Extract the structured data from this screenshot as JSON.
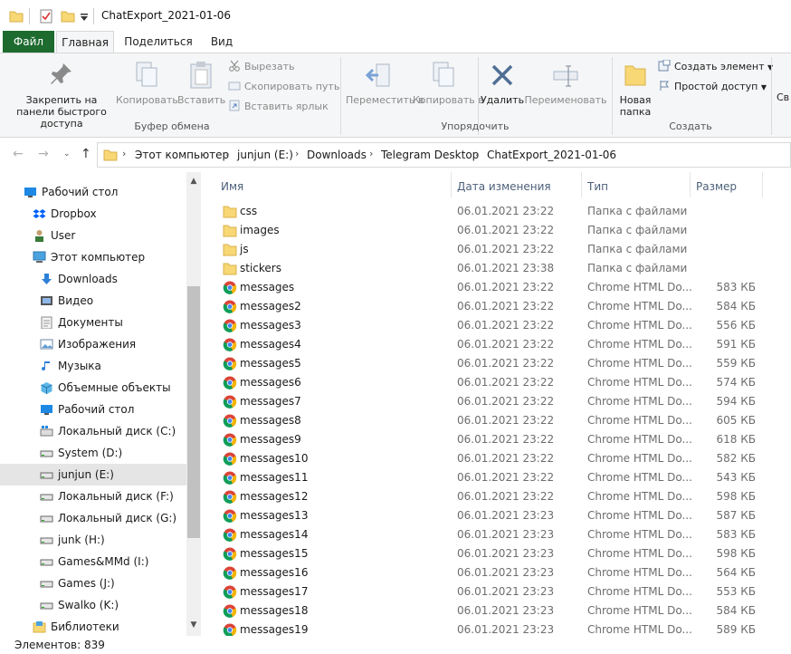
{
  "window": {
    "title": "ChatExport_2021-01-06"
  },
  "ribbon_tabs": {
    "file": "Файл",
    "home": "Главная",
    "share": "Поделиться",
    "view": "Вид"
  },
  "ribbon": {
    "pin": "Закрепить на панели быстрого доступа",
    "copy": "Копировать",
    "paste": "Вставить",
    "cut": "Вырезать",
    "copy_path": "Скопировать путь",
    "paste_shortcut": "Вставить ярлык",
    "clipboard_group": "Буфер обмена",
    "move_to": "Переместить в",
    "copy_to": "Копировать в",
    "delete": "Удалить",
    "rename": "Переименовать",
    "organize_group": "Упорядочить",
    "new_folder": "Новая папка",
    "new_item": "Создать элемент",
    "easy_access": "Простой доступ",
    "new_group": "Создать",
    "properties_partial": "Св"
  },
  "address": {
    "crumbs": [
      "Этот компьютер",
      "junjun (E:)",
      "Downloads",
      "Telegram Desktop",
      "ChatExport_2021-01-06"
    ]
  },
  "nav": [
    {
      "label": "Рабочий стол",
      "icon": "desktop-icon"
    },
    {
      "label": "Dropbox",
      "icon": "dropbox-icon"
    },
    {
      "label": "User",
      "icon": "user-icon"
    },
    {
      "label": "Этот компьютер",
      "icon": "computer-icon"
    },
    {
      "label": "Downloads",
      "icon": "download-icon"
    },
    {
      "label": "Видео",
      "icon": "video-icon"
    },
    {
      "label": "Документы",
      "icon": "documents-icon"
    },
    {
      "label": "Изображения",
      "icon": "pictures-icon"
    },
    {
      "label": "Музыка",
      "icon": "music-icon"
    },
    {
      "label": "Объемные объекты",
      "icon": "3d-objects-icon"
    },
    {
      "label": "Рабочий стол",
      "icon": "desktop-icon"
    },
    {
      "label": "Локальный диск (C:)",
      "icon": "windows-drive-icon"
    },
    {
      "label": "System (D:)",
      "icon": "drive-icon"
    },
    {
      "label": "junjun (E:)",
      "icon": "drive-icon"
    },
    {
      "label": "Локальный диск (F:)",
      "icon": "drive-icon"
    },
    {
      "label": "Локальный диск (G:)",
      "icon": "drive-icon"
    },
    {
      "label": "junk (H:)",
      "icon": "drive-icon"
    },
    {
      "label": "Games&MMd (I:)",
      "icon": "drive-icon"
    },
    {
      "label": "Games (J:)",
      "icon": "drive-icon"
    },
    {
      "label": "Swalko (K:)",
      "icon": "drive-icon"
    },
    {
      "label": "Библиотеки",
      "icon": "libraries-icon"
    }
  ],
  "columns": {
    "name": "Имя",
    "date": "Дата изменения",
    "type": "Тип",
    "size": "Размер"
  },
  "files": [
    {
      "name": "css",
      "date": "06.01.2021 23:22",
      "type": "Папка с файлами",
      "size": "",
      "kind": "folder"
    },
    {
      "name": "images",
      "date": "06.01.2021 23:22",
      "type": "Папка с файлами",
      "size": "",
      "kind": "folder"
    },
    {
      "name": "js",
      "date": "06.01.2021 23:22",
      "type": "Папка с файлами",
      "size": "",
      "kind": "folder"
    },
    {
      "name": "stickers",
      "date": "06.01.2021 23:38",
      "type": "Папка с файлами",
      "size": "",
      "kind": "folder"
    },
    {
      "name": "messages",
      "date": "06.01.2021 23:22",
      "type": "Chrome HTML Do...",
      "size": "583 КБ",
      "kind": "chrome"
    },
    {
      "name": "messages2",
      "date": "06.01.2021 23:22",
      "type": "Chrome HTML Do...",
      "size": "584 КБ",
      "kind": "chrome"
    },
    {
      "name": "messages3",
      "date": "06.01.2021 23:22",
      "type": "Chrome HTML Do...",
      "size": "556 КБ",
      "kind": "chrome"
    },
    {
      "name": "messages4",
      "date": "06.01.2021 23:22",
      "type": "Chrome HTML Do...",
      "size": "591 КБ",
      "kind": "chrome"
    },
    {
      "name": "messages5",
      "date": "06.01.2021 23:22",
      "type": "Chrome HTML Do...",
      "size": "559 КБ",
      "kind": "chrome"
    },
    {
      "name": "messages6",
      "date": "06.01.2021 23:22",
      "type": "Chrome HTML Do...",
      "size": "574 КБ",
      "kind": "chrome"
    },
    {
      "name": "messages7",
      "date": "06.01.2021 23:22",
      "type": "Chrome HTML Do...",
      "size": "594 КБ",
      "kind": "chrome"
    },
    {
      "name": "messages8",
      "date": "06.01.2021 23:22",
      "type": "Chrome HTML Do...",
      "size": "605 КБ",
      "kind": "chrome"
    },
    {
      "name": "messages9",
      "date": "06.01.2021 23:22",
      "type": "Chrome HTML Do...",
      "size": "618 КБ",
      "kind": "chrome"
    },
    {
      "name": "messages10",
      "date": "06.01.2021 23:22",
      "type": "Chrome HTML Do...",
      "size": "582 КБ",
      "kind": "chrome"
    },
    {
      "name": "messages11",
      "date": "06.01.2021 23:22",
      "type": "Chrome HTML Do...",
      "size": "543 КБ",
      "kind": "chrome"
    },
    {
      "name": "messages12",
      "date": "06.01.2021 23:22",
      "type": "Chrome HTML Do...",
      "size": "598 КБ",
      "kind": "chrome"
    },
    {
      "name": "messages13",
      "date": "06.01.2021 23:23",
      "type": "Chrome HTML Do...",
      "size": "587 КБ",
      "kind": "chrome"
    },
    {
      "name": "messages14",
      "date": "06.01.2021 23:23",
      "type": "Chrome HTML Do...",
      "size": "583 КБ",
      "kind": "chrome"
    },
    {
      "name": "messages15",
      "date": "06.01.2021 23:23",
      "type": "Chrome HTML Do...",
      "size": "598 КБ",
      "kind": "chrome"
    },
    {
      "name": "messages16",
      "date": "06.01.2021 23:23",
      "type": "Chrome HTML Do...",
      "size": "564 КБ",
      "kind": "chrome"
    },
    {
      "name": "messages17",
      "date": "06.01.2021 23:23",
      "type": "Chrome HTML Do...",
      "size": "553 КБ",
      "kind": "chrome"
    },
    {
      "name": "messages18",
      "date": "06.01.2021 23:23",
      "type": "Chrome HTML Do...",
      "size": "584 КБ",
      "kind": "chrome"
    },
    {
      "name": "messages19",
      "date": "06.01.2021 23:23",
      "type": "Chrome HTML Do...",
      "size": "589 КБ",
      "kind": "chrome"
    }
  ],
  "status": {
    "count": "Элементов: 839"
  },
  "colors": {
    "file_tab": "#1d6b2f",
    "selection": "#cce8ff",
    "folder": "#f8d775",
    "header_text": "#4c607a"
  }
}
